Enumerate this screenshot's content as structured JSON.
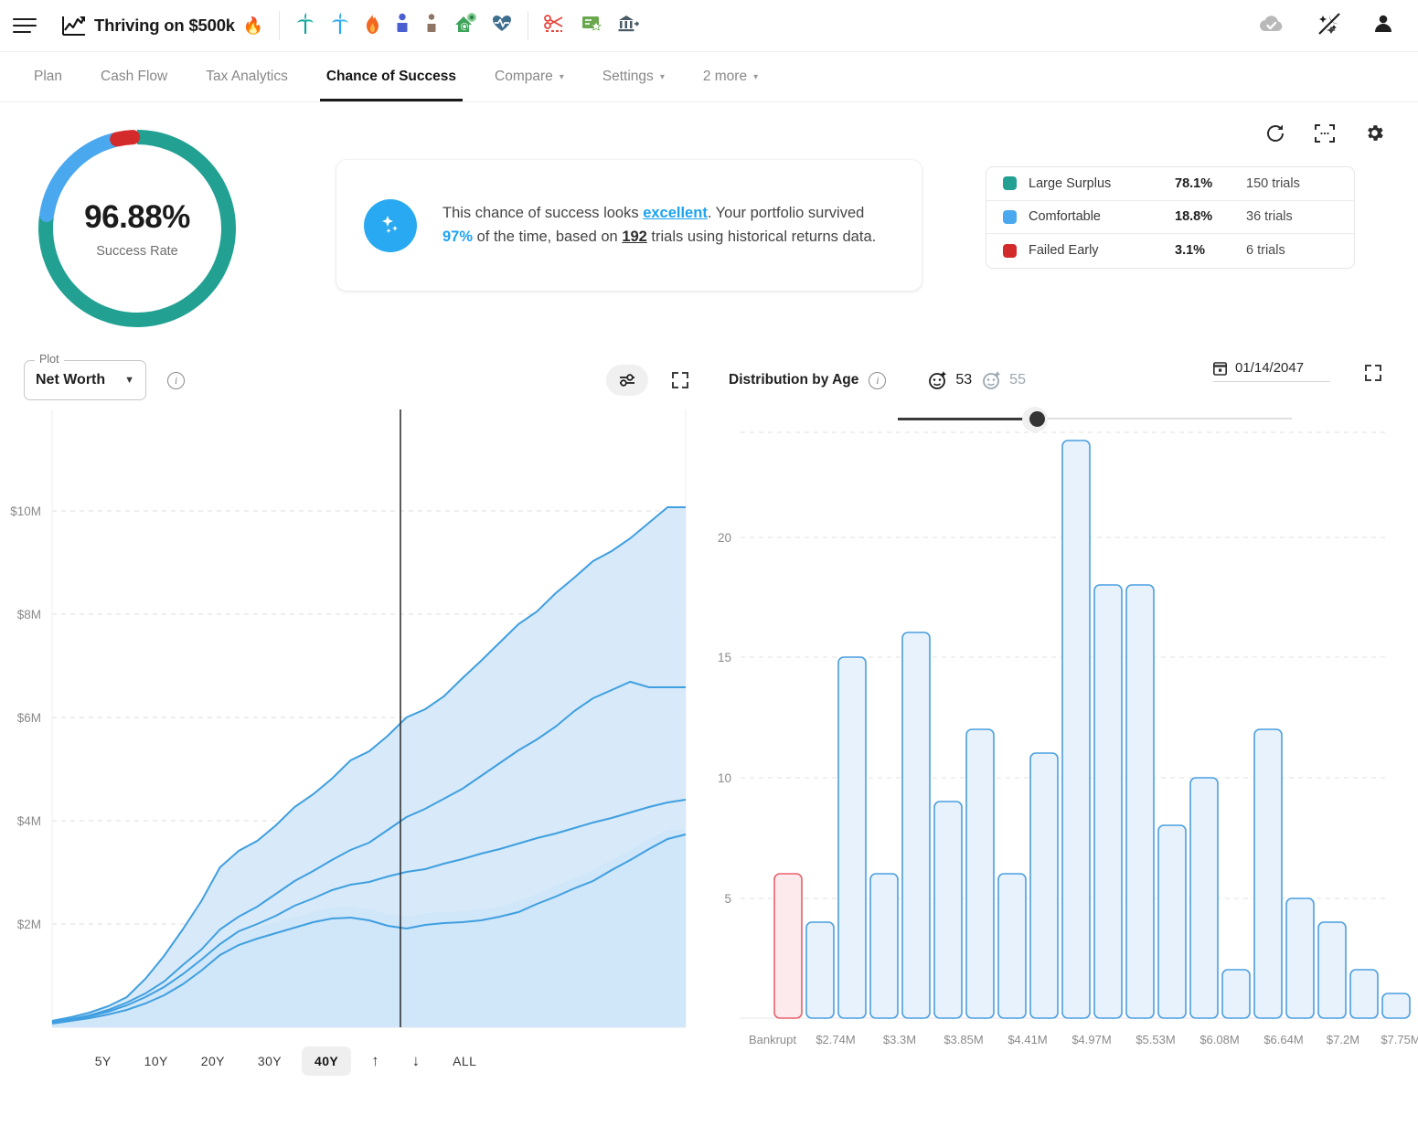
{
  "header": {
    "menu_icon": "hamburger-icon",
    "logo_icon": "chart-line-logo",
    "title": "Thriving on $500k",
    "flame": "🔥",
    "toolbar_icons": [
      {
        "name": "palm-tree-teal-icon",
        "glyph": "🌴",
        "color": "#16a39a"
      },
      {
        "name": "palm-tree-blue-icon",
        "glyph": "🌴",
        "color": "#2aa8e8"
      },
      {
        "name": "fire-icon",
        "glyph": "🔥",
        "color": "#f26522"
      },
      {
        "name": "person-blue-icon",
        "glyph": "👤",
        "color": "#4a5fd0"
      },
      {
        "name": "person-brown-icon",
        "glyph": "👤",
        "color": "#8d7566"
      },
      {
        "name": "house-search-icon",
        "glyph": "🏠",
        "color": "#3fa45b"
      },
      {
        "name": "heart-pulse-icon",
        "glyph": "💓",
        "color": "#3e6e8e"
      }
    ],
    "toolbar_icons_2": [
      {
        "name": "scissors-icon",
        "glyph": "✂",
        "color": "#e8453c"
      },
      {
        "name": "certificate-icon",
        "glyph": "🏅",
        "color": "#6aa84f"
      },
      {
        "name": "bank-exit-icon",
        "glyph": "🏛",
        "color": "#4a5a66"
      }
    ],
    "right_icons": [
      {
        "name": "cloud-saved-icon",
        "glyph": "☁"
      },
      {
        "name": "magic-wand-off-icon",
        "glyph": "✨"
      },
      {
        "name": "account-avatar-icon",
        "glyph": "👤"
      }
    ]
  },
  "tabs": [
    {
      "label": "Plan",
      "active": false,
      "dropdown": false
    },
    {
      "label": "Cash Flow",
      "active": false,
      "dropdown": false
    },
    {
      "label": "Tax Analytics",
      "active": false,
      "dropdown": false
    },
    {
      "label": "Chance of Success",
      "active": true,
      "dropdown": false
    },
    {
      "label": "Compare",
      "active": false,
      "dropdown": true
    },
    {
      "label": "Settings",
      "active": false,
      "dropdown": true
    },
    {
      "label": "2 more",
      "active": false,
      "dropdown": true
    }
  ],
  "top_actions": [
    {
      "name": "refresh-button",
      "glyph": "⟳"
    },
    {
      "name": "scan-fullscreen-button",
      "glyph": "⛶"
    },
    {
      "name": "settings-gear-button",
      "glyph": "⚙"
    }
  ],
  "success": {
    "percent": "96.88%",
    "label": "Success Rate",
    "donut_segments": [
      {
        "name": "Large Surplus",
        "value": 78.1,
        "color": "#22a193"
      },
      {
        "name": "Comfortable",
        "value": 18.8,
        "color": "#4aa8ef"
      },
      {
        "name": "Failed Early",
        "value": 3.1,
        "color": "#d32b2b"
      }
    ]
  },
  "info_card": {
    "icon": "sparkle-icon",
    "text_1": "This chance of success looks ",
    "highlight": "excellent",
    "text_2": ". Your portfolio survived ",
    "pct": "97%",
    "text_3": " of the time, based on ",
    "trials": "192",
    "text_4": " trials using historical returns data."
  },
  "legend": {
    "rows": [
      {
        "color": "#22a193",
        "name": "Large Surplus",
        "pct": "78.1%",
        "trials": "150 trials"
      },
      {
        "color": "#4aa8ef",
        "name": "Comfortable",
        "pct": "18.8%",
        "trials": "36 trials"
      },
      {
        "color": "#d32b2b",
        "name": "Failed Early",
        "pct": "3.1%",
        "trials": "6 trials"
      }
    ]
  },
  "plot_panel": {
    "select_legend": "Plot",
    "select_value": "Net Worth",
    "info_icon": "info-icon",
    "tune_icon": "sliders-icon",
    "expand_icon": "fullscreen-icon",
    "ranges": [
      "5Y",
      "10Y",
      "20Y",
      "30Y",
      "40Y"
    ],
    "active_range": "40Y",
    "up_arrow": "↑",
    "down_arrow": "↓",
    "all_label": "ALL"
  },
  "distribution_panel": {
    "title": "Distribution by Age",
    "info_icon": "info-icon",
    "age_primary": "53",
    "age_secondary": "55",
    "age_primary_icon": "face-primary-icon",
    "age_secondary_icon": "face-secondary-icon",
    "date": "01/14/2047",
    "calendar_icon": "calendar-icon",
    "expand_icon": "fullscreen-icon",
    "slider_name": "age-slider"
  },
  "chart_data": [
    {
      "type": "area",
      "title": "Net Worth",
      "xlabel": "",
      "ylabel": "",
      "ylim": [
        0,
        11000000
      ],
      "ytick_labels": [
        "$2M",
        "$4M",
        "$6M",
        "$8M",
        "$10M"
      ],
      "ytick_values": [
        2000000,
        4000000,
        6000000,
        8000000,
        10000000
      ],
      "grid": true,
      "marker_line_x_fraction": 0.55,
      "series": [
        {
          "name": "p90",
          "color": "#3f9fe0",
          "values": [
            0.12,
            0.2,
            0.32,
            0.5,
            0.75,
            1.1,
            1.55,
            2.05,
            2.6,
            3.25,
            3.6,
            3.8,
            4.1,
            4.45,
            4.7,
            5.0,
            5.35,
            5.55,
            5.85,
            6.2,
            6.35,
            6.6,
            6.95,
            7.3,
            7.65,
            8.0,
            8.25,
            8.6,
            9.0,
            9.35,
            9.55,
            9.8,
            10.1,
            10.4
          ]
        },
        {
          "name": "p75",
          "color": "#3f9fe0",
          "values": [
            0.1,
            0.17,
            0.27,
            0.42,
            0.62,
            0.88,
            1.2,
            1.6,
            2.05,
            2.55,
            2.9,
            3.1,
            3.35,
            3.6,
            3.8,
            4.0,
            4.2,
            4.35,
            4.6,
            4.85,
            5.0,
            5.2,
            5.4,
            5.65,
            5.9,
            6.15,
            6.35,
            6.6,
            6.9,
            7.15,
            7.3,
            7.45,
            7.35,
            7.35
          ]
        },
        {
          "name": "p50",
          "color": "#3f9fe0",
          "values": [
            0.09,
            0.15,
            0.24,
            0.36,
            0.52,
            0.72,
            0.98,
            1.3,
            1.65,
            2.05,
            2.3,
            2.45,
            2.6,
            2.8,
            2.95,
            3.1,
            3.2,
            3.25,
            3.35,
            3.45,
            3.5,
            3.6,
            3.7,
            3.8,
            3.9,
            4.0,
            4.1,
            4.2,
            4.3,
            4.4,
            4.5,
            4.6,
            4.7,
            4.8
          ]
        },
        {
          "name": "p10",
          "color": "#3f9fe0",
          "values": [
            0.08,
            0.13,
            0.2,
            0.3,
            0.43,
            0.58,
            0.78,
            1.0,
            1.28,
            1.58,
            1.78,
            1.9,
            2.0,
            2.1,
            2.2,
            2.28,
            2.3,
            2.25,
            2.15,
            2.1,
            2.18,
            2.2,
            2.22,
            2.25,
            2.3,
            2.4,
            2.55,
            2.7,
            2.85,
            3.0,
            3.2,
            3.4,
            3.6,
            3.78
          ]
        }
      ]
    },
    {
      "type": "bar",
      "title": "Distribution by Age",
      "xlabel": "",
      "ylabel": "",
      "ylim": [
        0,
        26
      ],
      "ytick_labels": [
        "5",
        "10",
        "15",
        "20"
      ],
      "ytick_values": [
        5,
        10,
        15,
        20
      ],
      "grid": true,
      "categories": [
        "Bankrupt",
        "$2.74M",
        "$3.3M",
        "$3.85M",
        "$4.41M",
        "$4.97M",
        "$5.53M",
        "$6.08M",
        "$6.64M",
        "$7.2M",
        "$7.75M"
      ],
      "bars": [
        {
          "value": 6,
          "color": "#e8606a",
          "fill": "#fdeaec",
          "bankrupt": true
        },
        {
          "value": 4,
          "color": "#4a9fe0",
          "fill": "#e7f2fc",
          "bankrupt": false
        },
        {
          "value": 15,
          "color": "#4a9fe0",
          "fill": "#e7f2fc",
          "bankrupt": false
        },
        {
          "value": 6,
          "color": "#4a9fe0",
          "fill": "#e7f2fc",
          "bankrupt": false
        },
        {
          "value": 16,
          "color": "#4a9fe0",
          "fill": "#e7f2fc",
          "bankrupt": false
        },
        {
          "value": 9,
          "color": "#4a9fe0",
          "fill": "#e7f2fc",
          "bankrupt": false
        },
        {
          "value": 12,
          "color": "#4a9fe0",
          "fill": "#e7f2fc",
          "bankrupt": false
        },
        {
          "value": 6,
          "color": "#4a9fe0",
          "fill": "#e7f2fc",
          "bankrupt": false
        },
        {
          "value": 11,
          "color": "#4a9fe0",
          "fill": "#e7f2fc",
          "bankrupt": false
        },
        {
          "value": 24,
          "color": "#4a9fe0",
          "fill": "#e7f2fc",
          "bankrupt": false
        },
        {
          "value": 18,
          "color": "#4a9fe0",
          "fill": "#e7f2fc",
          "bankrupt": false
        },
        {
          "value": 18,
          "color": "#4a9fe0",
          "fill": "#e7f2fc",
          "bankrupt": false
        },
        {
          "value": 8,
          "color": "#4a9fe0",
          "fill": "#e7f2fc",
          "bankrupt": false
        },
        {
          "value": 10,
          "color": "#4a9fe0",
          "fill": "#e7f2fc",
          "bankrupt": false
        },
        {
          "value": 2,
          "color": "#4a9fe0",
          "fill": "#e7f2fc",
          "bankrupt": false
        },
        {
          "value": 12,
          "color": "#4a9fe0",
          "fill": "#e7f2fc",
          "bankrupt": false
        },
        {
          "value": 5,
          "color": "#4a9fe0",
          "fill": "#e7f2fc",
          "bankrupt": false
        },
        {
          "value": 4,
          "color": "#4a9fe0",
          "fill": "#e7f2fc",
          "bankrupt": false
        },
        {
          "value": 2,
          "color": "#4a9fe0",
          "fill": "#e7f2fc",
          "bankrupt": false
        },
        {
          "value": 1,
          "color": "#4a9fe0",
          "fill": "#e7f2fc",
          "bankrupt": false
        }
      ]
    }
  ]
}
